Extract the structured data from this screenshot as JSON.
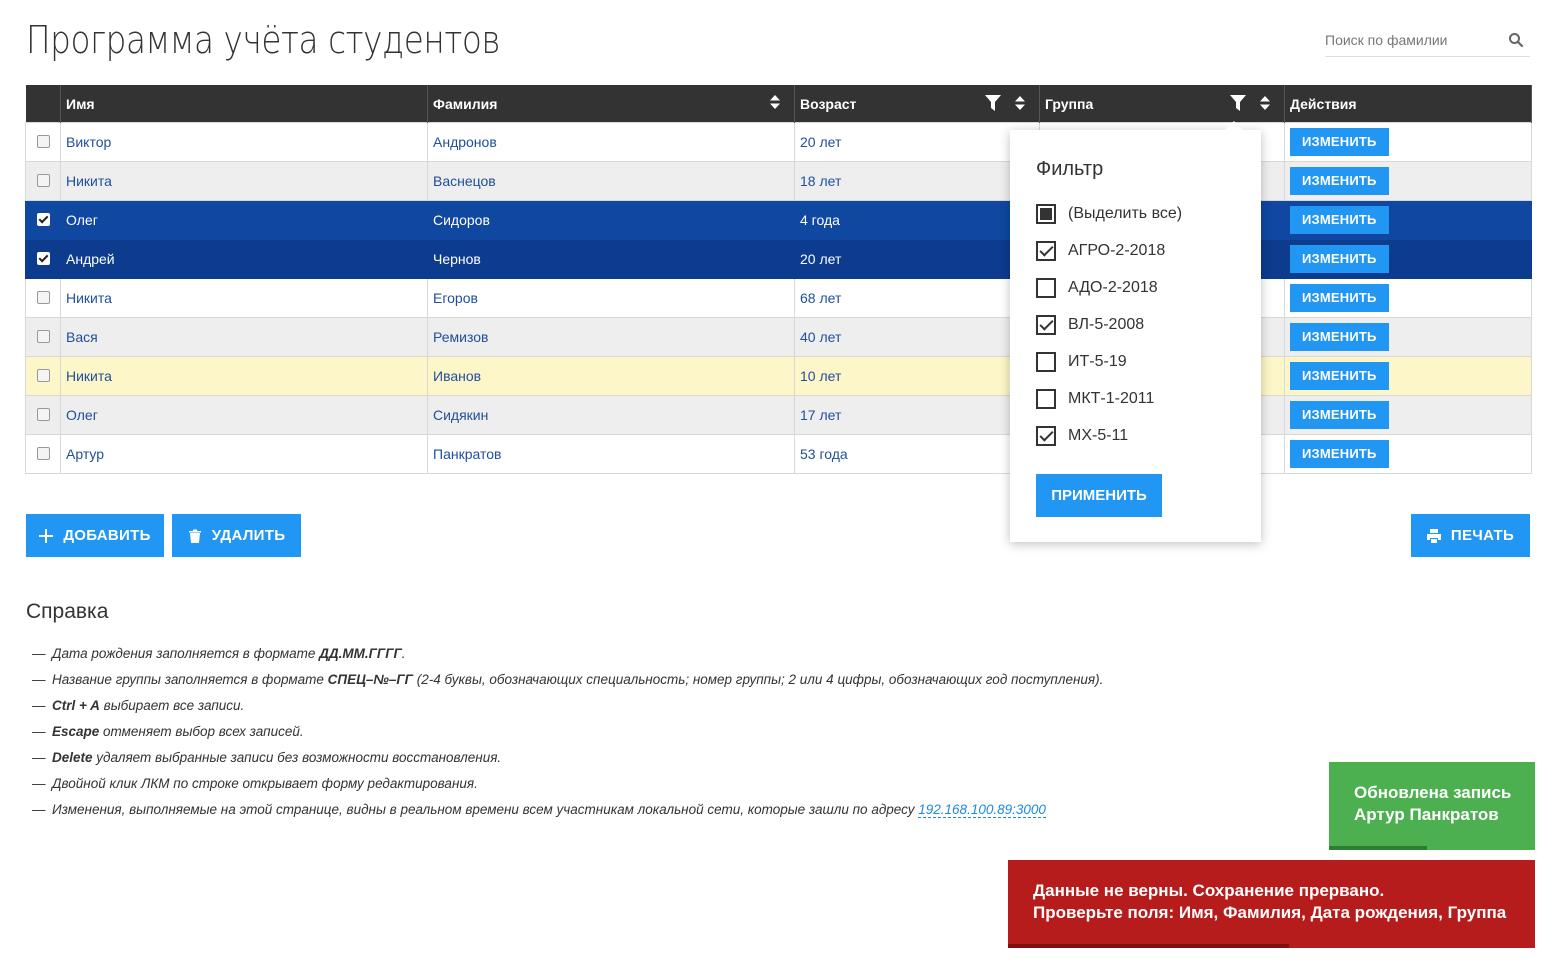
{
  "app": {
    "title": "Программа учёта студентов"
  },
  "search": {
    "placeholder": "Поиск по фамилии"
  },
  "table": {
    "headers": {
      "name": "Имя",
      "surname": "Фамилия",
      "age": "Возраст",
      "group": "Группа",
      "actions": "Действия"
    },
    "edit_label": "ИЗМЕНИТЬ",
    "rows": [
      {
        "checked": false,
        "name": "Виктор",
        "surname": "Андронов",
        "age": "20 лет",
        "style": "odd"
      },
      {
        "checked": false,
        "name": "Никита",
        "surname": "Васнецов",
        "age": "18 лет",
        "style": "even"
      },
      {
        "checked": true,
        "name": "Олег",
        "surname": "Сидоров",
        "age": "4 года",
        "style": "sel1"
      },
      {
        "checked": true,
        "name": "Андрей",
        "surname": "Чернов",
        "age": "20 лет",
        "style": "sel2"
      },
      {
        "checked": false,
        "name": "Никита",
        "surname": "Егоров",
        "age": "68 лет",
        "style": "odd"
      },
      {
        "checked": false,
        "name": "Вася",
        "surname": "Ремизов",
        "age": "40 лет",
        "style": "even"
      },
      {
        "checked": false,
        "name": "Никита",
        "surname": "Иванов",
        "age": "10 лет",
        "style": "yellow"
      },
      {
        "checked": false,
        "name": "Олег",
        "surname": "Сидякин",
        "age": "17 лет",
        "style": "even"
      },
      {
        "checked": false,
        "name": "Артур",
        "surname": "Панкратов",
        "age": "53 года",
        "style": "odd"
      }
    ]
  },
  "buttons": {
    "add": "ДОБАВИТЬ",
    "delete": "УДАЛИТЬ",
    "print": "ПЕЧАТЬ"
  },
  "filter": {
    "title": "Фильтр",
    "select_all": "(Выделить все)",
    "options": [
      {
        "label": "АГРО-2-2018",
        "checked": true
      },
      {
        "label": "АДО-2-2018",
        "checked": false
      },
      {
        "label": "ВЛ-5-2008",
        "checked": true
      },
      {
        "label": "ИТ-5-19",
        "checked": false
      },
      {
        "label": "МКТ-1-2011",
        "checked": false
      },
      {
        "label": "МХ-5-11",
        "checked": true
      }
    ],
    "apply": "ПРИМЕНИТЬ"
  },
  "help": {
    "title": "Справка",
    "items": [
      {
        "pre": "Дата рождения заполняется в формате ",
        "bold": "ДД.ММ.ГГГГ",
        "post": "."
      },
      {
        "pre": "Название группы заполняется в формате ",
        "bold": "СПЕЦ–№–ГГ",
        "post": " (2-4 буквы, обозначающих специальность; номер группы; 2 или 4 цифры, обозначающих год поступления)."
      },
      {
        "pre": "",
        "bold": "Ctrl + A",
        "post": " выбирает все записи."
      },
      {
        "pre": "",
        "bold": "Escape",
        "post": " отменяет выбор всех записей."
      },
      {
        "pre": "",
        "bold": "Delete",
        "post": " удаляет выбранные записи без возможности восстановления."
      },
      {
        "pre": "Двойной клик ЛКМ по строке открывает форму редактирования.",
        "bold": "",
        "post": ""
      },
      {
        "pre": "Изменения, выполняемые на этой странице, видны в реальном времени всем участникам локальной сети, которые зашли по адресу ",
        "bold": "",
        "post": "",
        "link": "192.168.100.89:3000"
      }
    ]
  },
  "toasts": {
    "success": {
      "line1": "Обновлена запись",
      "line2": "Артур Панкратов",
      "color": "#4caf50"
    },
    "error": {
      "line1": "Данные не верны. Сохранение прервано.",
      "line2": "Проверьте поля: Имя, Фамилия, Дата рождения, Группа",
      "color": "#b71c1c"
    }
  },
  "colors": {
    "accent": "#2196f3",
    "header": "#333333",
    "selected": "#0f47a1"
  }
}
